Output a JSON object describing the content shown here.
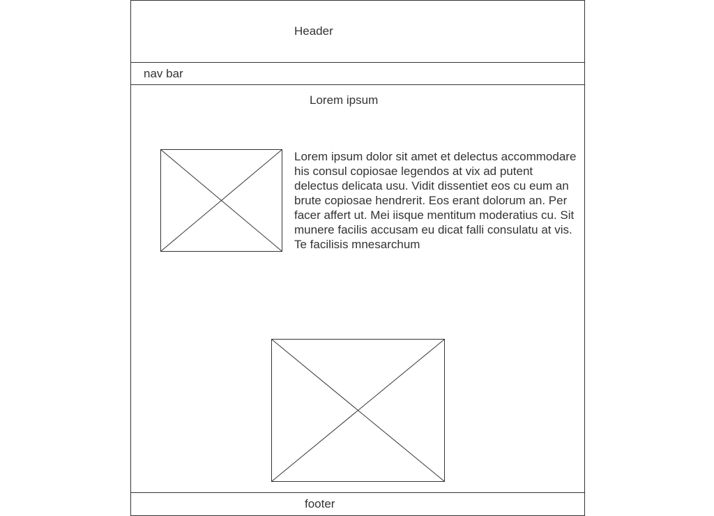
{
  "header": {
    "label": "Header"
  },
  "nav": {
    "label": "nav bar"
  },
  "main": {
    "title": "Lorem ipsum",
    "paragraph": "Lorem ipsum dolor sit amet et delectus accommodare his consul copiosae legendos at vix ad putent delectus delicata usu. Vidit dissentiet eos cu eum an brute copiosae hendrerit. Eos erant dolorum an. Per facer affert ut. Mei iisque mentitum moderatius cu. Sit munere facilis accusam eu dicat falli consulatu at vis. Te facilisis mnesarchum",
    "images": [
      {
        "icon": "image-placeholder-icon"
      },
      {
        "icon": "image-placeholder-icon"
      }
    ]
  },
  "footer": {
    "label": "footer"
  },
  "colors": {
    "line": "#333333",
    "background": "#ffffff"
  }
}
